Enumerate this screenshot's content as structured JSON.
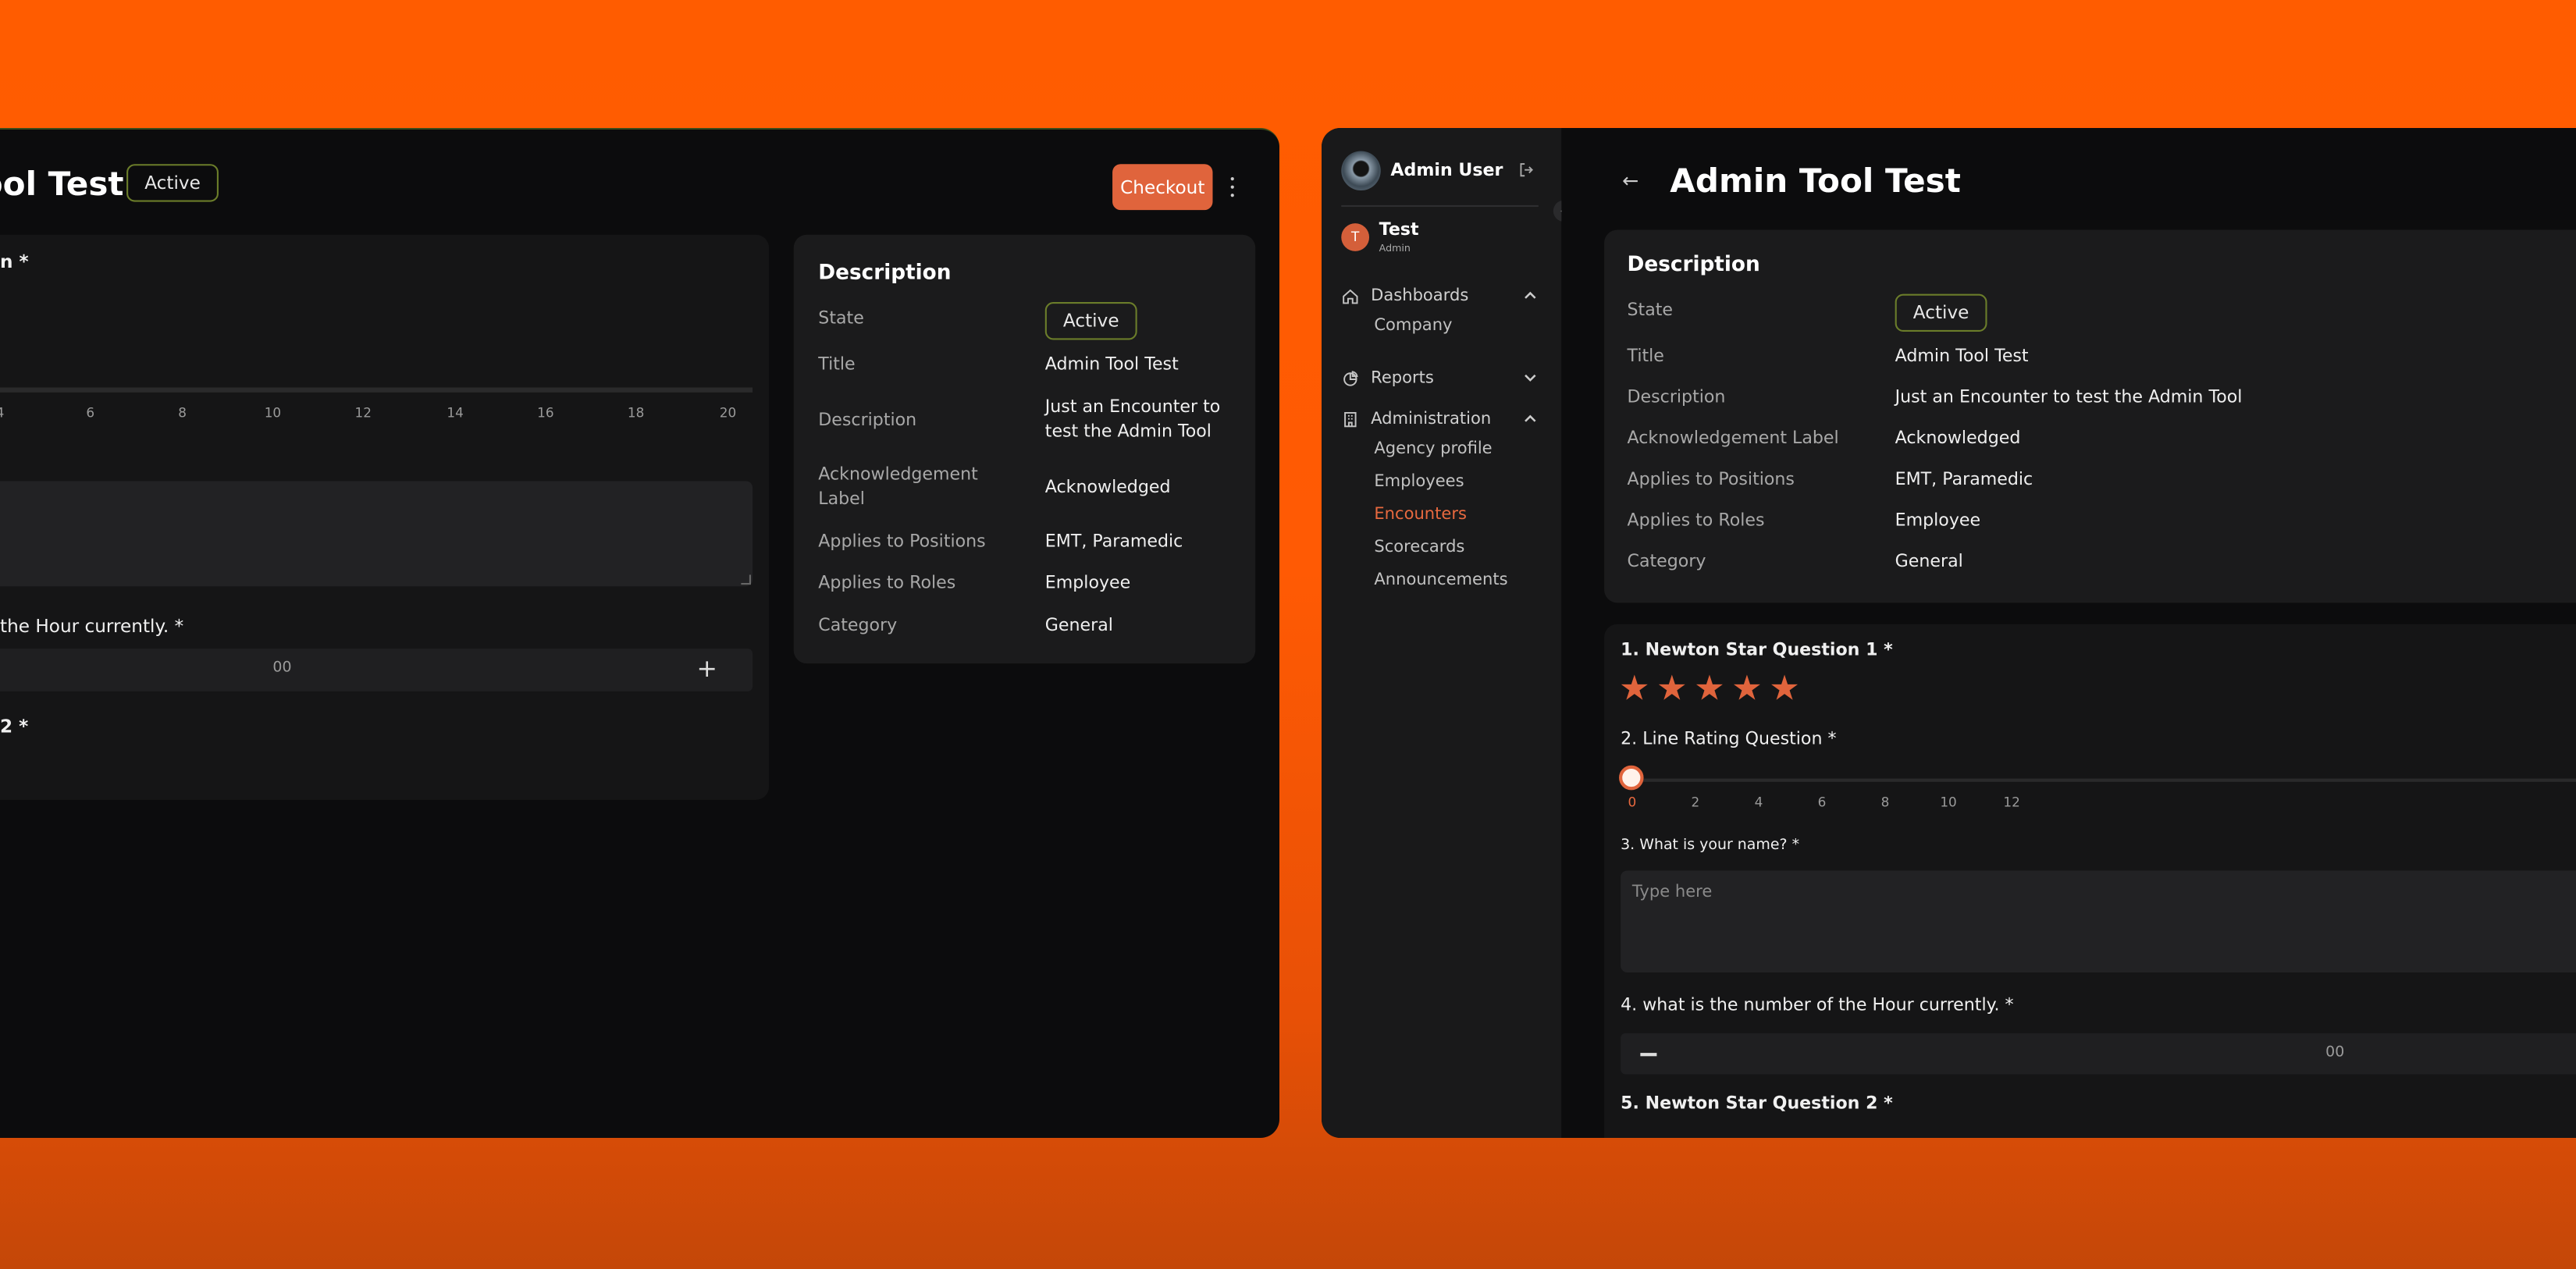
{
  "theme": {
    "accent": "#e0643c",
    "background_gradient": "#ff5c00",
    "badge_border": "#6b7d2a"
  },
  "left_window": {
    "title": "ool Test",
    "status_badge": "Active",
    "checkout_label": "Checkout",
    "more_icon": "kebab-icon",
    "form": {
      "q1_label": "n *",
      "slider_ticks": [
        "4",
        "6",
        "8",
        "10",
        "12",
        "14",
        "16",
        "18",
        "20"
      ],
      "q4_label": "the Hour currently. *",
      "stepper_value": "00",
      "stepper_plus": "+",
      "q5_label": "2 *"
    },
    "description_card": {
      "title": "Description",
      "rows": [
        {
          "label": "State",
          "value": "Active"
        },
        {
          "label": "Title",
          "value": "Admin Tool Test"
        },
        {
          "label": "Description",
          "value": "Just an Encounter to test the Admin Tool"
        },
        {
          "label": "Acknowledgement Label",
          "value": "Acknowledged"
        },
        {
          "label": "Applies to Positions",
          "value": "EMT, Paramedic"
        },
        {
          "label": "Applies to Roles",
          "value": "Employee"
        },
        {
          "label": "Category",
          "value": "General"
        }
      ]
    }
  },
  "right_window": {
    "sidebar": {
      "user_name": "Admin User",
      "collapse_icon": "«",
      "org": {
        "initial": "T",
        "name": "Test",
        "role": "Admin"
      },
      "nav": [
        {
          "label": "Dashboards",
          "icon": "home-icon",
          "expanded": true
        },
        {
          "label": "Reports",
          "icon": "reports-icon",
          "expanded": false
        },
        {
          "label": "Administration",
          "icon": "building-icon",
          "expanded": true
        }
      ],
      "dashboards_sub": [
        "Company"
      ],
      "admin_sub": [
        "Agency profile",
        "Employees",
        "Encounters",
        "Scorecards",
        "Announcements"
      ],
      "active_item": "Encounters"
    },
    "main": {
      "back_icon": "←",
      "title": "Admin Tool Test",
      "description_card": {
        "title": "Description",
        "rows": [
          {
            "label": "State",
            "value": "Active"
          },
          {
            "label": "Title",
            "value": "Admin Tool Test"
          },
          {
            "label": "Description",
            "value": "Just an Encounter to test the Admin Tool"
          },
          {
            "label": "Acknowledgement Label",
            "value": "Acknowledged"
          },
          {
            "label": "Applies to Positions",
            "value": "EMT, Paramedic"
          },
          {
            "label": "Applies to Roles",
            "value": "Employee"
          },
          {
            "label": "Category",
            "value": "General"
          }
        ]
      },
      "form": {
        "q1_label": "1. Newton Star Question 1 *",
        "star_count": 5,
        "star_glyph": "★",
        "q2_label": "2. Line Rating Question *",
        "slider_value": 0,
        "slider_ticks": [
          "0",
          "2",
          "4",
          "6",
          "8",
          "10",
          "12"
        ],
        "q3_label": "3. What is your name? *",
        "q3_placeholder": "Type here",
        "q4_label": "4. what is the number of the Hour currently. *",
        "stepper_value": "00",
        "q5_label": "5. Newton Star Question 2 *"
      }
    }
  }
}
